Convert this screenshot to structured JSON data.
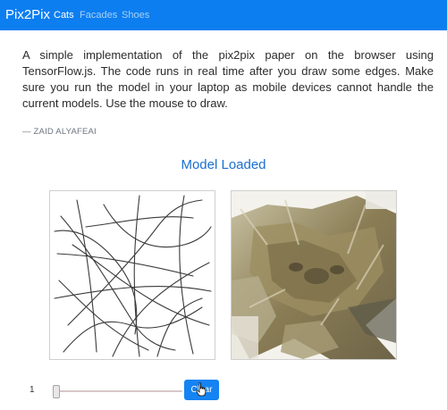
{
  "navbar": {
    "brand": "Pix2Pix",
    "links": [
      {
        "label": "Cats",
        "active": true
      },
      {
        "label": "Facades",
        "active": false
      },
      {
        "label": "Shoes",
        "active": false
      }
    ]
  },
  "intro": {
    "text": "A simple implementation of the pix2pix paper on the browser using TensorFlow.js. The code runs in real time after you draw some edges. Make sure you run the model in your laptop as mobile devices cannot handle the current models. Use the mouse to draw.",
    "author": "— ZAID ALYAFEAI"
  },
  "status": "Model Loaded",
  "controls": {
    "slider_value": "1",
    "clear_label": "Clear"
  },
  "colors": {
    "navbar": "#0d7ef0",
    "status": "#1a6fd0",
    "button": "#1583f2"
  }
}
